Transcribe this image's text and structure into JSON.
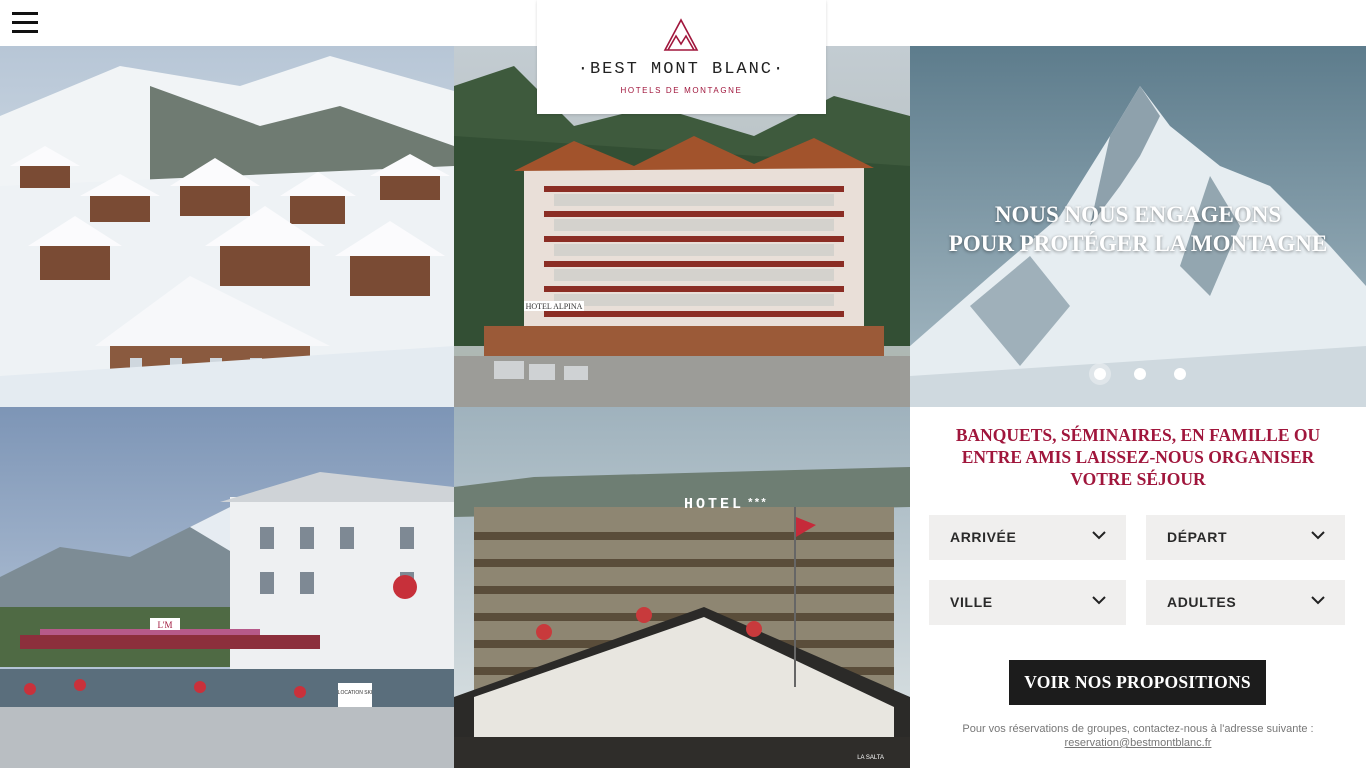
{
  "header": {
    "menu_icon": "hamburger-menu-icon",
    "logo": {
      "name": "·BEST MONT BLANC·",
      "tagline": "HOTELS DE MONTAGNE",
      "icon": "mountain-logo-icon",
      "accent_color": "#a0163c"
    }
  },
  "gallery": {
    "tiles": [
      {
        "image": "snowy-village-photo"
      },
      {
        "image": "hotel-alpina-photo"
      },
      {
        "image": "mountain-peak-photo"
      },
      {
        "image": "hotel-terrace-photo"
      },
      {
        "image": "hotel-facade-photo"
      }
    ],
    "photo_signs": {
      "alpina": "HOTEL ALPINA",
      "hotel": "HOTEL",
      "stars": "***",
      "lm": "L'M",
      "ski": "LOCATION SKI",
      "salta": "LA SALTA"
    }
  },
  "hero": {
    "line1": "NOUS NOUS ENGAGEONS",
    "line2": "POUR PROTÉGER LA MONTAGNE",
    "slides": 3,
    "active_slide": 1
  },
  "booking": {
    "title_line1": "BANQUETS, SÉMINAIRES, EN FAMILLE OU",
    "title_line2": "ENTRE AMIS LAISSEZ-NOUS ORGANISER",
    "title_line3": "VOTRE SÉJOUR",
    "fields": {
      "arrival": "ARRIVÉE",
      "departure": "DÉPART",
      "city": "VILLE",
      "adults": "ADULTES"
    },
    "cta_label": "VOIR NOS PROPOSITIONS",
    "note": "Pour vos réservations de groupes, contactez-nous à l'adresse suivante :",
    "email": "reservation@bestmontblanc.fr"
  }
}
